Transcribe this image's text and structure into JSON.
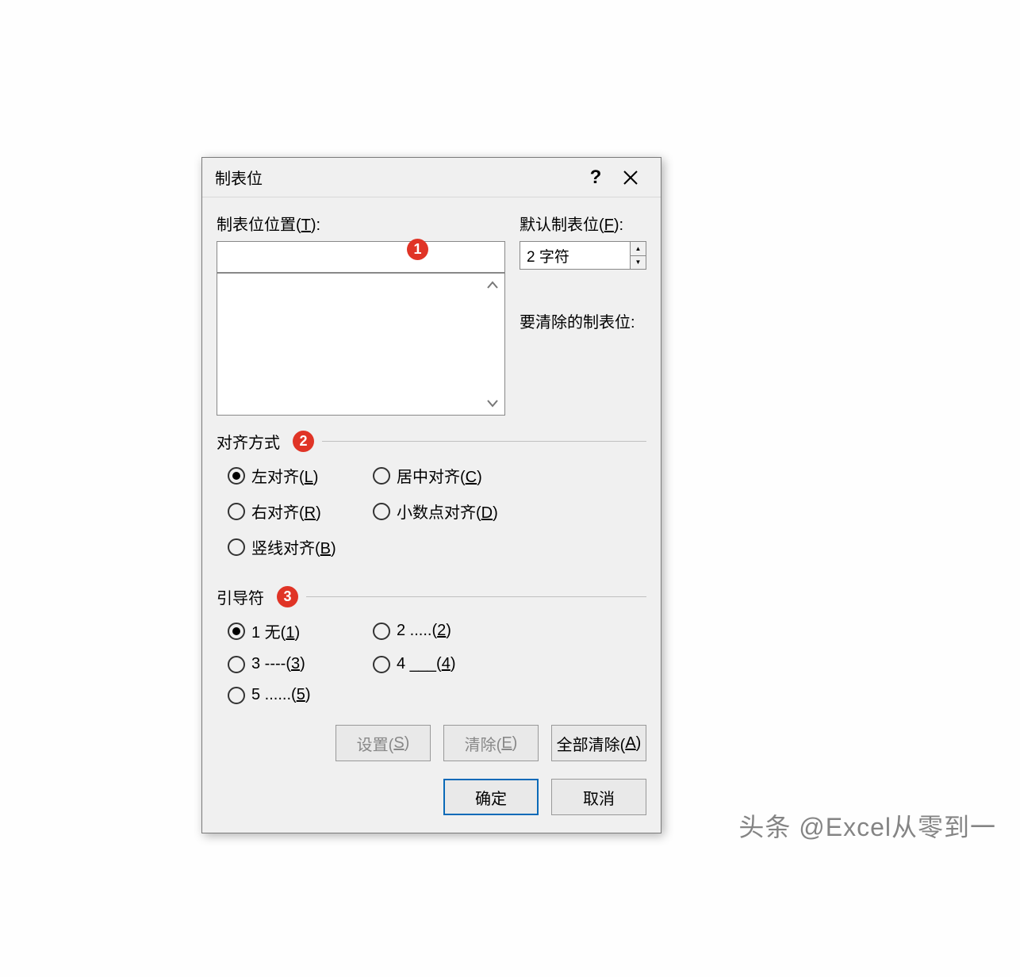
{
  "dialog": {
    "title": "制表位",
    "tab_position_label_prefix": "制表位位置(",
    "tab_position_label_key": "T",
    "tab_position_label_suffix": "):",
    "tab_position_value": "",
    "default_tab_label_prefix": "默认制表位(",
    "default_tab_label_key": "F",
    "default_tab_label_suffix": "):",
    "default_tab_value": "2 字符",
    "clear_label": "要清除的制表位:"
  },
  "alignment": {
    "section_title": "对齐方式",
    "options": [
      {
        "label_prefix": "左对齐(",
        "key": "L",
        "label_suffix": ")",
        "checked": true
      },
      {
        "label_prefix": "居中对齐(",
        "key": "C",
        "label_suffix": ")",
        "checked": false
      },
      {
        "label_prefix": "右对齐(",
        "key": "R",
        "label_suffix": ")",
        "checked": false
      },
      {
        "label_prefix": "小数点对齐(",
        "key": "D",
        "label_suffix": ")",
        "checked": false
      },
      {
        "label_prefix": "竖线对齐(",
        "key": "B",
        "label_suffix": ")",
        "checked": false
      }
    ]
  },
  "leader": {
    "section_title": "引导符",
    "options": [
      {
        "label_prefix": "1 无(",
        "key": "1",
        "label_suffix": ")",
        "checked": true
      },
      {
        "label_prefix": "2 .....(",
        "key": "2",
        "label_suffix": ")",
        "checked": false
      },
      {
        "label_prefix": "3 ----(",
        "key": "3",
        "label_suffix": ")",
        "checked": false
      },
      {
        "label_prefix": "4 ___(",
        "key": "4",
        "label_suffix": ")",
        "checked": false
      },
      {
        "label_prefix": "5 ......(",
        "key": "5",
        "label_suffix": ")",
        "checked": false
      }
    ]
  },
  "buttons": {
    "set_prefix": "设置(",
    "set_key": "S",
    "set_suffix": ")",
    "clear_prefix": "清除(",
    "clear_key": "E",
    "clear_suffix": ")",
    "clear_all_prefix": "全部清除(",
    "clear_all_key": "A",
    "clear_all_suffix": ")",
    "ok": "确定",
    "cancel": "取消"
  },
  "markers": {
    "m1": "1",
    "m2": "2",
    "m3": "3"
  },
  "watermark": "头条 @Excel从零到一"
}
